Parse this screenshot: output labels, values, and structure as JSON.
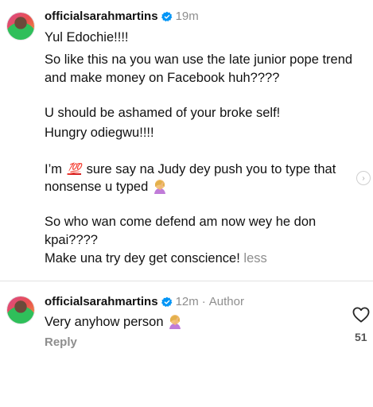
{
  "comments": [
    {
      "username": "officialsarahmartins",
      "time": "19m",
      "lines": [
        "Yul Edochie!!!!",
        "So like this na you wan use the late junior pope trend",
        "and make money on Facebook huh????",
        "U should be ashamed of your broke self!",
        "Hungry odiegwu!!!!",
        "I’m",
        "sure say na Judy dey push you to type that",
        "nonsense u typed",
        "So who wan come defend am now wey he don",
        "kpai????",
        "Make una try dey get conscience!"
      ],
      "hundred_emoji": "💯",
      "more_label": "less"
    },
    {
      "username": "officialsarahmartins",
      "time": "12m",
      "separator": "·",
      "role": "Author",
      "text": "Very anyhow person",
      "reply_label": "Reply",
      "likes": "51"
    }
  ],
  "icons": {
    "verified": "verified-badge-icon",
    "like": "heart-icon",
    "facepalm": "woman-facepalming-emoji"
  },
  "colors": {
    "verified": "#0095f6",
    "muted": "#8e8e8e"
  }
}
